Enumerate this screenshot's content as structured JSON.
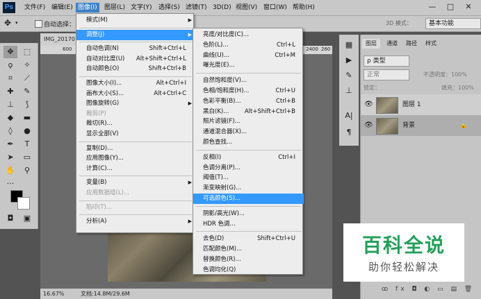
{
  "app": {
    "logo": "Ps"
  },
  "menubar": {
    "items": [
      "文件(F)",
      "编辑(E)",
      "图像(I)",
      "图层(L)",
      "文字(Y)",
      "选择(S)",
      "滤镜(T)",
      "3D(D)",
      "视图(V)",
      "窗口(W)",
      "帮助(H)"
    ],
    "active": "图像(I)",
    "window_buttons": [
      "—",
      "□",
      "✕"
    ]
  },
  "optionsbar": {
    "auto_select": "自动选择：",
    "mode_3d": "3D 模式：",
    "workspace": "基本功能"
  },
  "document": {
    "tab": "IMG_20170",
    "ruler_left": "600",
    "ruler_right": [
      "2400",
      "260"
    ],
    "zoom": "16.67%",
    "doc_size": "文档:14.8M/29.6M"
  },
  "image_menu": [
    {
      "label": "模式(M)",
      "shortcut": "",
      "submenu": true
    },
    {
      "sep": true
    },
    {
      "label": "调整(J)",
      "shortcut": "",
      "submenu": true,
      "highlight": true
    },
    {
      "sep": true
    },
    {
      "label": "自动色调(N)",
      "shortcut": "Shift+Ctrl+L"
    },
    {
      "label": "自动对比度(U)",
      "shortcut": "Alt+Shift+Ctrl+L"
    },
    {
      "label": "自动颜色(O)",
      "shortcut": "Shift+Ctrl+B"
    },
    {
      "sep": true
    },
    {
      "label": "图像大小(I)...",
      "shortcut": "Alt+Ctrl+I"
    },
    {
      "label": "画布大小(S)...",
      "shortcut": "Alt+Ctrl+C"
    },
    {
      "label": "图像旋转(G)",
      "shortcut": "",
      "submenu": true
    },
    {
      "label": "裁剪(P)",
      "shortcut": "",
      "disabled": true
    },
    {
      "label": "裁切(R)...",
      "shortcut": ""
    },
    {
      "label": "显示全部(V)",
      "shortcut": ""
    },
    {
      "sep": true
    },
    {
      "label": "复制(D)...",
      "shortcut": ""
    },
    {
      "label": "应用图像(Y)...",
      "shortcut": ""
    },
    {
      "label": "计算(C)...",
      "shortcut": ""
    },
    {
      "sep": true
    },
    {
      "label": "变量(B)",
      "shortcut": "",
      "submenu": true
    },
    {
      "label": "应用数据组(L)...",
      "shortcut": "",
      "disabled": true
    },
    {
      "sep": true
    },
    {
      "label": "陷印(T)...",
      "shortcut": "",
      "disabled": true
    },
    {
      "sep": true
    },
    {
      "label": "分析(A)",
      "shortcut": "",
      "submenu": true
    }
  ],
  "adjust_menu": [
    {
      "label": "亮度/对比度(C)...",
      "shortcut": ""
    },
    {
      "label": "色阶(L)...",
      "shortcut": "Ctrl+L"
    },
    {
      "label": "曲线(U)...",
      "shortcut": "Ctrl+M"
    },
    {
      "label": "曝光度(E)...",
      "shortcut": ""
    },
    {
      "sep": true
    },
    {
      "label": "自然饱和度(V)...",
      "shortcut": ""
    },
    {
      "label": "色相/饱和度(H)...",
      "shortcut": "Ctrl+U"
    },
    {
      "label": "色彩平衡(B)...",
      "shortcut": "Ctrl+B"
    },
    {
      "label": "黑白(K)...",
      "shortcut": "Alt+Shift+Ctrl+B"
    },
    {
      "label": "照片滤镜(F)...",
      "shortcut": ""
    },
    {
      "label": "通道混合器(X)...",
      "shortcut": ""
    },
    {
      "label": "颜色查找...",
      "shortcut": ""
    },
    {
      "sep": true
    },
    {
      "label": "反相(I)",
      "shortcut": "Ctrl+I"
    },
    {
      "label": "色调分离(P)...",
      "shortcut": ""
    },
    {
      "label": "阈值(T)...",
      "shortcut": ""
    },
    {
      "label": "渐变映射(G)...",
      "shortcut": ""
    },
    {
      "label": "可选颜色(S)...",
      "shortcut": "",
      "highlight": true
    },
    {
      "sep": true
    },
    {
      "label": "阴影/高光(W)...",
      "shortcut": ""
    },
    {
      "label": "HDR 色调...",
      "shortcut": ""
    },
    {
      "sep": true
    },
    {
      "label": "去色(D)",
      "shortcut": "Shift+Ctrl+U"
    },
    {
      "label": "匹配颜色(M)...",
      "shortcut": ""
    },
    {
      "label": "替换颜色(R)...",
      "shortcut": ""
    },
    {
      "label": "色调均化(Q)",
      "shortcut": ""
    }
  ],
  "panel": {
    "tabs": [
      "图层",
      "通道",
      "路径",
      "样式"
    ],
    "kind": "ρ 类型",
    "blend": "正常",
    "opacity": "不透明度：100%",
    "lock": "锁定：",
    "fill": "填充：100%",
    "layers": [
      {
        "name": "图层 1"
      },
      {
        "name": "背景",
        "locked": true
      }
    ]
  },
  "watermark": {
    "title": "百科全说",
    "subtitle": "助你轻松解决"
  }
}
